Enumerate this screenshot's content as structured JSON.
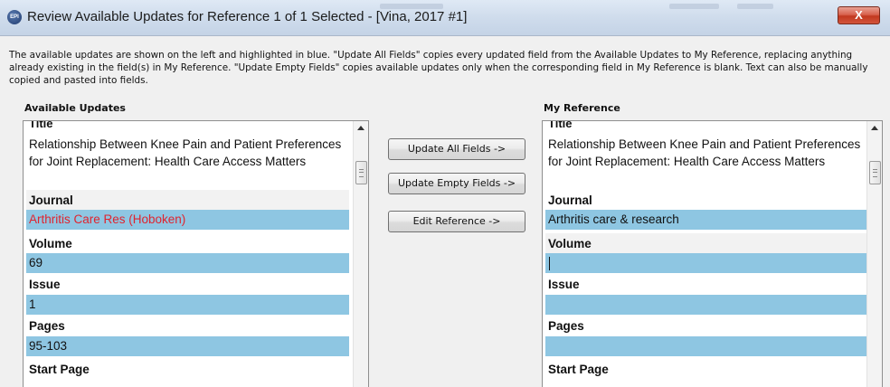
{
  "window": {
    "icon_label": "EPI",
    "title": "Review Available Updates for Reference 1 of 1 Selected - [Vina, 2017 #1]",
    "close_label": "X"
  },
  "description": "The available updates are shown on the left and highlighted in blue. \"Update All Fields\" copies every updated field from the Available Updates to My Reference, replacing anything already existing in the field(s) in My Reference. \"Update Empty Fields\" copies available updates only when the corresponding field in My Reference is blank. Text can also be manually copied and pasted into fields.",
  "available_updates": {
    "heading": "Available Updates",
    "title_label": "Title",
    "title_value": "Relationship Between Knee Pain and Patient Preferences for Joint Replacement: Health Care Access Matters",
    "fields": [
      {
        "label": "Journal",
        "value": "Arthritis Care Res (Hoboken)"
      },
      {
        "label": "Volume",
        "value": "69"
      },
      {
        "label": "Issue",
        "value": "1"
      },
      {
        "label": "Pages",
        "value": "95-103"
      },
      {
        "label": "Start Page",
        "value": ""
      }
    ]
  },
  "my_reference": {
    "heading": "My Reference",
    "title_label": "Title",
    "title_value": "Relationship Between Knee Pain and Patient Preferences for Joint Replacement: Health Care Access Matters",
    "fields": [
      {
        "label": "Journal",
        "value": "Arthritis care & research"
      },
      {
        "label": "Volume",
        "value": ""
      },
      {
        "label": "Issue",
        "value": ""
      },
      {
        "label": "Pages",
        "value": ""
      },
      {
        "label": "Start Page",
        "value": ""
      }
    ]
  },
  "buttons": {
    "update_all": "Update All Fields ->",
    "update_empty": "Update Empty Fields ->",
    "edit_reference": "Edit Reference ->"
  },
  "colors": {
    "highlight": "#8ec6e2",
    "changed_text": "#e0232e"
  }
}
